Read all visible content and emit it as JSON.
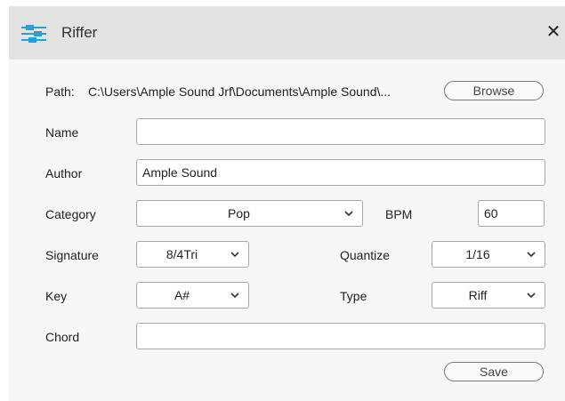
{
  "window": {
    "title": "Riffer",
    "close_glyph": "✕"
  },
  "path": {
    "label": "Path:",
    "value": "C:\\Users\\Ample Sound Jrf\\Documents\\Ample Sound\\...",
    "browse_label": "Browse"
  },
  "fields": {
    "name_label": "Name",
    "name_value": "",
    "author_label": "Author",
    "author_value": "Ample Sound",
    "category_label": "Category",
    "category_value": "Pop",
    "bpm_label": "BPM",
    "bpm_value": "60",
    "signature_label": "Signature",
    "signature_value": "8/4Tri",
    "quantize_label": "Quantize",
    "quantize_value": "1/16",
    "key_label": "Key",
    "key_value": "A#",
    "type_label": "Type",
    "type_value": "Riff",
    "chord_label": "Chord",
    "chord_value": ""
  },
  "actions": {
    "save_label": "Save"
  },
  "icons": {
    "app": "sliders-icon",
    "dropdown": "chevron-down-icon"
  },
  "colors": {
    "accent": "#2a9fd6",
    "titlebar": "#e3e3e3",
    "background": "#f7f7f7"
  }
}
